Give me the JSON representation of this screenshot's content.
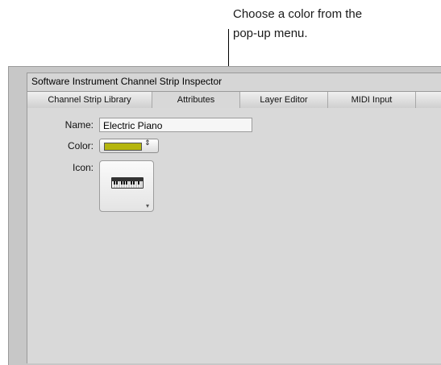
{
  "callout": {
    "line1": "Choose a color from the",
    "line2": "pop-up menu."
  },
  "inspector": {
    "title": "Software Instrument Channel Strip Inspector",
    "tabs": [
      "Channel Strip Library",
      "Attributes",
      "Layer Editor",
      "MIDI Input"
    ],
    "active_tab": "Attributes"
  },
  "attributes": {
    "name_label": "Name:",
    "name_value": "Electric Piano",
    "color_label": "Color:",
    "color_value_hex": "#b5b60f",
    "color_arrows": "⇕",
    "icon_label": "Icon:",
    "icon_name": "keyboard-icon",
    "icon_menu_arrow": "▾"
  }
}
